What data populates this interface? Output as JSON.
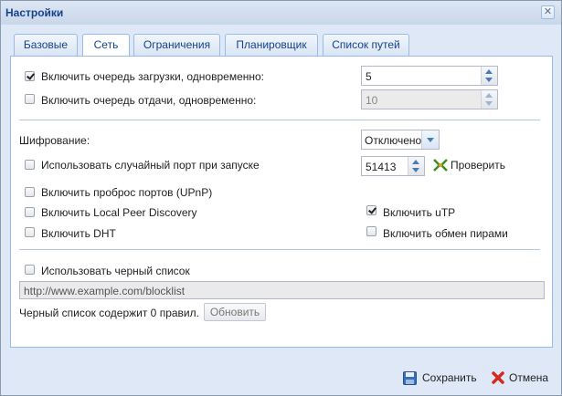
{
  "window": {
    "title": "Настройки"
  },
  "tabs": [
    {
      "label": "Базовые"
    },
    {
      "label": "Сеть"
    },
    {
      "label": "Ограничения"
    },
    {
      "label": "Планировщик"
    },
    {
      "label": "Список путей"
    }
  ],
  "queue": {
    "download_label": "Включить очередь загрузки, одновременно:",
    "download_value": "5",
    "upload_label": "Включить очередь отдачи, одновременно:",
    "upload_value": "10"
  },
  "network": {
    "encryption_label": "Шифрование:",
    "encryption_value": "Отключено",
    "random_port_label": "Использовать случайный порт при запуске",
    "port_value": "51413",
    "check_label": "Проверить",
    "upnp_label": "Включить проброс портов (UPnP)",
    "lpd_label": "Включить Local Peer Discovery",
    "dht_label": "Включить DHT",
    "utp_label": "Включить uTP",
    "pex_label": "Включить обмен пирами"
  },
  "blocklist": {
    "use_label": "Использовать черный список",
    "url": "http://www.example.com/blocklist",
    "status": "Черный список содержит 0 правил.",
    "update_label": "Обновить"
  },
  "footer": {
    "save_label": "Сохранить",
    "cancel_label": "Отмена"
  }
}
